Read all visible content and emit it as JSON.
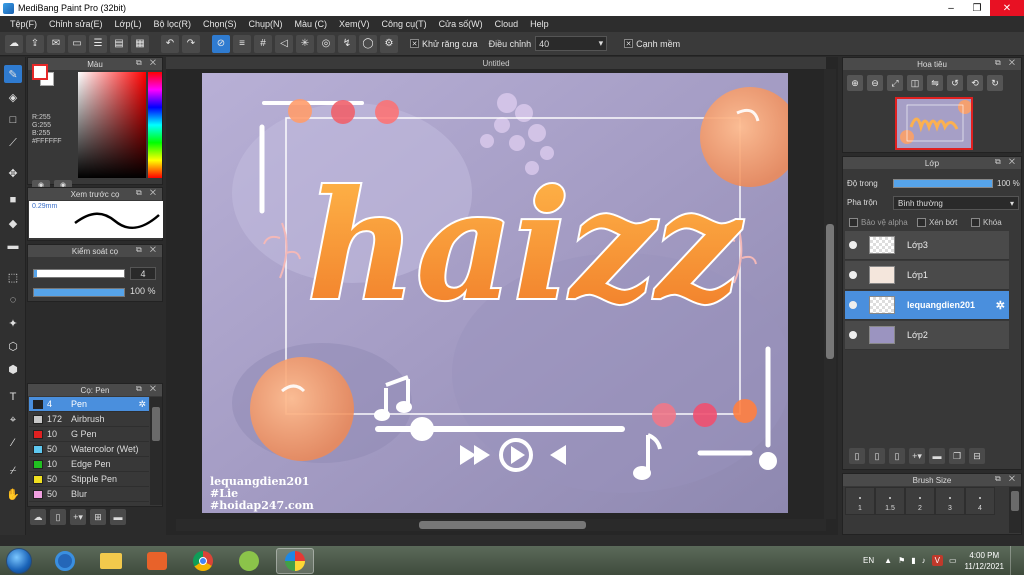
{
  "window": {
    "title": "MediBang Paint Pro (32bit)",
    "minimize": "–",
    "maximize": "❐",
    "close": "✕"
  },
  "menu": [
    "Tệp(F)",
    "Chỉnh sửa(E)",
    "Lớp(L)",
    "Bộ lọc(R)",
    "Chọn(S)",
    "Chụp(N)",
    "Màu (C)",
    "Xem(V)",
    "Công cụ(T)",
    "Cửa số(W)",
    "Cloud",
    "Help"
  ],
  "toolbar": {
    "antialias_label": "Khử răng cưa",
    "adjust_label": "Điều chỉnh",
    "adjust_value": "40",
    "smooth_label": "Cạnh mềm",
    "check_mark": "✕",
    "dropdown_arrow": "▾"
  },
  "color_panel": {
    "title": "Màu",
    "r": "R:255",
    "g": "G:255",
    "b": "B:255",
    "hex": "#FFFFFF",
    "fg_color": "#ffffff",
    "bg_color": "#ffffff"
  },
  "preview_panel": {
    "title": "Xem trước cọ",
    "size_label": "0.29mm"
  },
  "brush_control": {
    "title": "Kiểm soát cọ",
    "size_value": "4",
    "opacity_value": "100 %",
    "opacity": 1.0
  },
  "brush_panel": {
    "title": "Cọ: Pen",
    "items": [
      {
        "size": "4",
        "name": "Pen",
        "color": "#222222",
        "selected": true
      },
      {
        "size": "172",
        "name": "Airbrush",
        "color": "#c8c8c8",
        "selected": false
      },
      {
        "size": "10",
        "name": "G Pen",
        "color": "#e02020",
        "selected": false
      },
      {
        "size": "50",
        "name": "Watercolor (Wet)",
        "color": "#5ec8f0",
        "selected": false
      },
      {
        "size": "10",
        "name": "Edge Pen",
        "color": "#20c020",
        "selected": false
      },
      {
        "size": "50",
        "name": "Stipple Pen",
        "color": "#f0e020",
        "selected": false
      },
      {
        "size": "50",
        "name": "Blur",
        "color": "#f0a0e0",
        "selected": false
      }
    ]
  },
  "document": {
    "tab": "Untitled"
  },
  "artwork": {
    "title": "haizz",
    "credit_line1": "lequangdien201",
    "credit_line2": "#Lie",
    "credit_line3": "#hoidap247.com"
  },
  "navigator": {
    "title": "Hoa tiêu"
  },
  "layers_panel": {
    "title": "Lớp",
    "opacity_label": "Độ trong",
    "opacity_value": "100 %",
    "opacity": 1.0,
    "blend_label": "Pha trộn",
    "blend_value": "Bình thường",
    "protect_alpha": "Bảo vệ alpha",
    "clipping": "Xén bớt",
    "lock": "Khóa",
    "layers": [
      {
        "name": "Lớp3",
        "selected": false
      },
      {
        "name": "Lớp1",
        "selected": false
      },
      {
        "name": "lequangdien201",
        "selected": true
      },
      {
        "name": "Lớp2",
        "selected": false
      }
    ]
  },
  "brush_size_panel": {
    "title": "Brush Size",
    "sizes": [
      "1",
      "1.5",
      "2",
      "3",
      "4"
    ]
  },
  "taskbar": {
    "language": "EN",
    "time": "4:00 PM",
    "date": "11/12/2021"
  }
}
